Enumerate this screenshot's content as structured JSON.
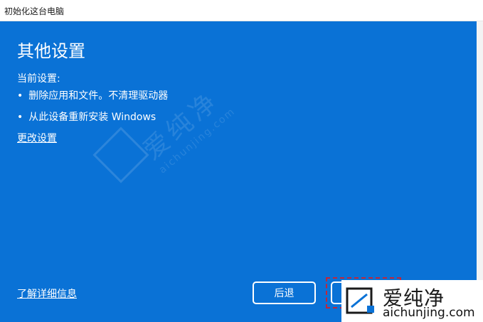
{
  "window": {
    "title": "初始化这台电脑"
  },
  "main": {
    "heading": "其他设置",
    "current_label": "当前设置:",
    "bullets": [
      "删除应用和文件。不清理驱动器",
      "从此设备重新安装 Windows"
    ],
    "change_link": "更改设置",
    "learn_more_link": "了解详细信息"
  },
  "buttons": {
    "back_label": "后退",
    "next_label": ""
  },
  "watermark": {
    "cn": "爱纯净",
    "en": "aichunjing.com"
  },
  "logo": {
    "cn": "爱纯净",
    "en": "aichunjing.com"
  },
  "colors": {
    "panel_blue": "#0a72d6",
    "focus_ring": "#c0263a",
    "text_white": "#ffffff"
  },
  "icons": {
    "bullet": "•",
    "logo": "aichunjing-logo-icon"
  }
}
